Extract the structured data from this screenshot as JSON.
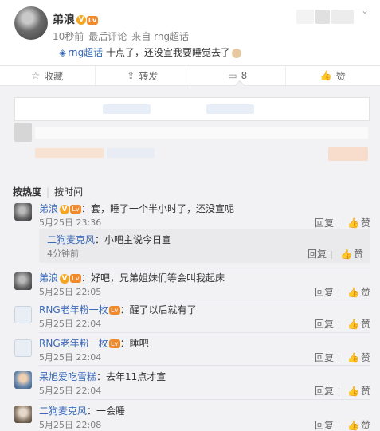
{
  "post": {
    "author": "弟浪",
    "vip_badge": "V",
    "level_badge": "Lv",
    "meta": [
      "10秒前",
      "最后评论",
      "来自 rng超话"
    ],
    "tag": "rng超话",
    "text": "十点了，还没宣我要睡觉去了",
    "chevron": "⌄"
  },
  "actions": [
    {
      "icon": "☆",
      "label": "收藏"
    },
    {
      "icon": "⇪",
      "label": "转发"
    },
    {
      "icon": "▭",
      "label": "8"
    },
    {
      "icon": "👍",
      "label": "赞"
    }
  ],
  "sort": {
    "hot": "按热度",
    "time": "按时间"
  },
  "comments": [
    {
      "name": "弟浪",
      "text": "：套，睡了一个半小时了，还没宣呢",
      "time": "5月25日 23:36",
      "reply": "回复",
      "like": "赞"
    },
    {
      "name": "弟浪",
      "text": "：好吧，兄弟姐妹们等会叫我起床",
      "time": "5月25日 22:05",
      "reply": "回复",
      "like": "赞"
    },
    {
      "name": "RNG老年粉一枚",
      "text": "：醒了以后就有了",
      "time": "5月25日 22:04",
      "reply": "回复",
      "like": "赞"
    },
    {
      "name": "RNG老年粉一枚",
      "text": "：睡吧",
      "time": "5月25日 22:04",
      "reply": "回复",
      "like": "赞"
    },
    {
      "name": "呆旭爱吃雪糕",
      "text": "：去年11点才宣",
      "time": "5月25日 22:04",
      "reply": "回复",
      "like": "赞"
    },
    {
      "name": "二狗麦克风",
      "text": "：一会睡",
      "time": "5月25日 22:08",
      "reply": "回复",
      "like": "赞"
    }
  ],
  "sub_reply": {
    "name": "二狗麦克风",
    "text": "：小吧主说今日宣",
    "time": "4分钟前",
    "reply": "回复",
    "like": "赞"
  }
}
